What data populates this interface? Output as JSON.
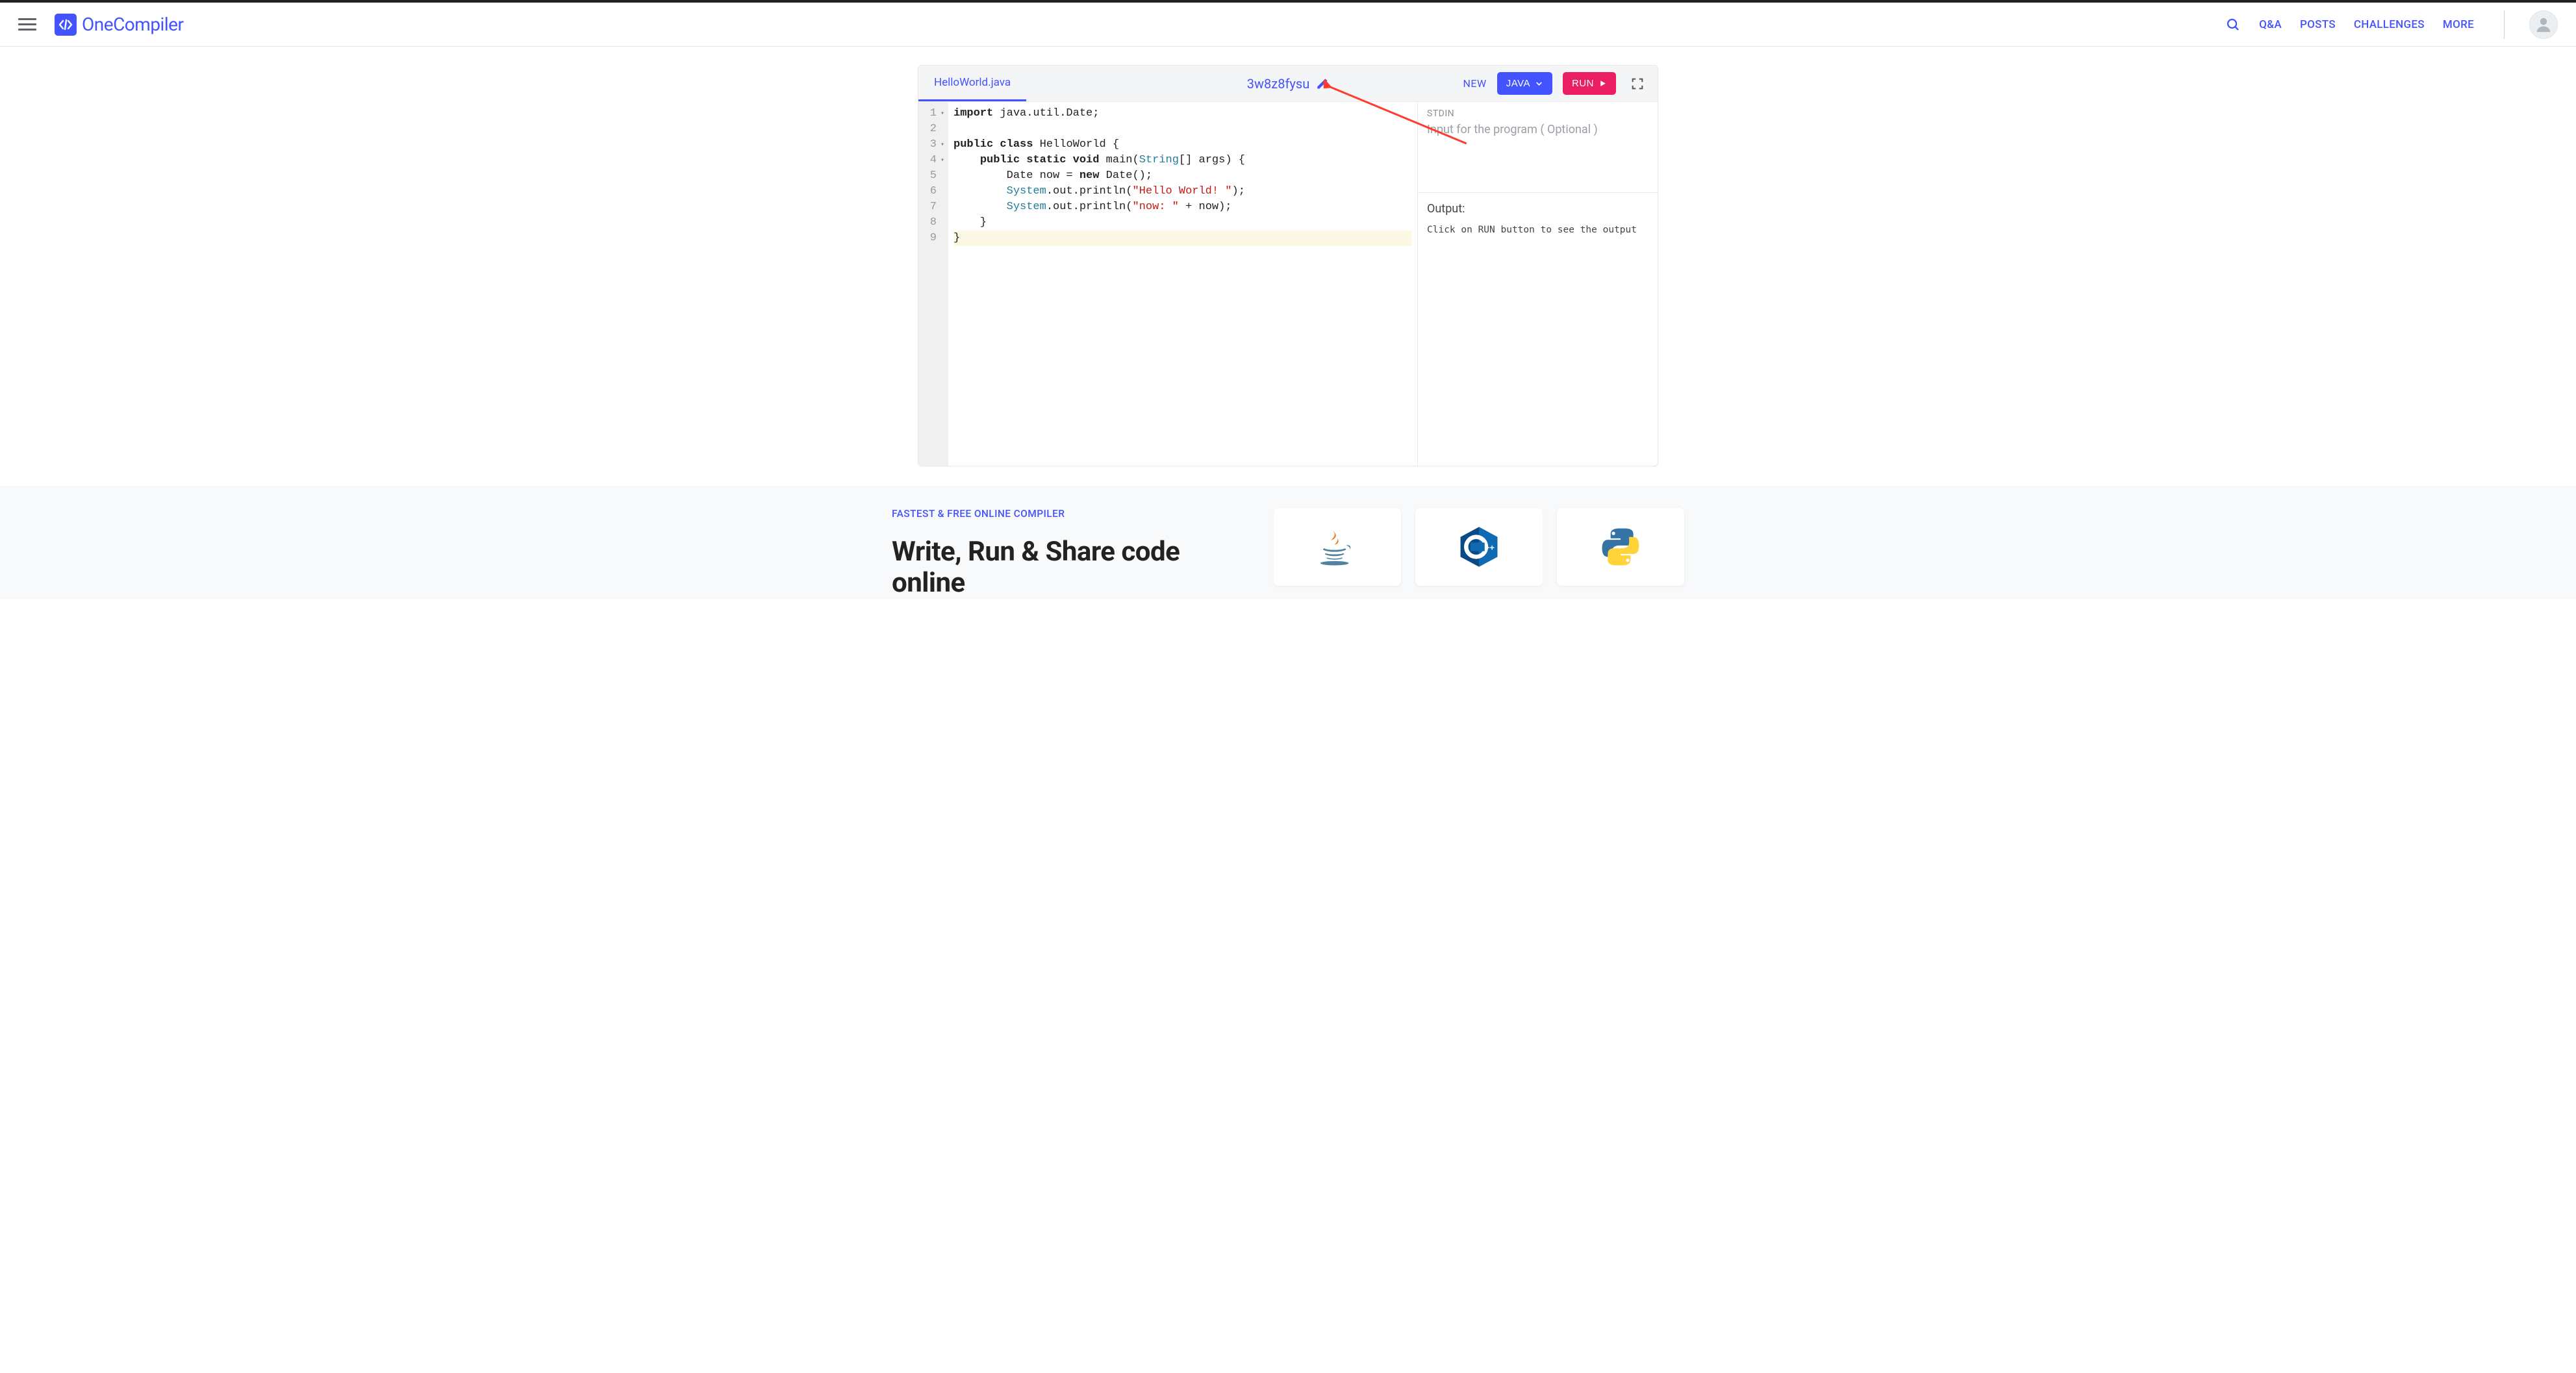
{
  "header": {
    "brand": "OneCompiler",
    "nav": {
      "qa": "Q&A",
      "posts": "POSTS",
      "challenges": "CHALLENGES",
      "more": "MORE"
    }
  },
  "panel": {
    "tab_filename": "HelloWorld.java",
    "snippet_id": "3w8z8fysu",
    "new_label": "NEW",
    "lang_label": "JAVA",
    "run_label": "RUN"
  },
  "code": {
    "lines": [
      {
        "n": "1",
        "fold": true,
        "tokens": [
          [
            "kw",
            "import"
          ],
          [
            "plain",
            " java.util.Date;"
          ]
        ]
      },
      {
        "n": "2",
        "fold": false,
        "tokens": []
      },
      {
        "n": "3",
        "fold": true,
        "tokens": [
          [
            "kw",
            "public"
          ],
          [
            "plain",
            " "
          ],
          [
            "kw",
            "class"
          ],
          [
            "plain",
            " HelloWorld {"
          ]
        ]
      },
      {
        "n": "4",
        "fold": true,
        "tokens": [
          [
            "plain",
            "    "
          ],
          [
            "kw",
            "public"
          ],
          [
            "plain",
            " "
          ],
          [
            "kw",
            "static"
          ],
          [
            "plain",
            " "
          ],
          [
            "kw",
            "void"
          ],
          [
            "plain",
            " main("
          ],
          [
            "type",
            "String"
          ],
          [
            "plain",
            "[] args) {"
          ]
        ]
      },
      {
        "n": "5",
        "fold": false,
        "tokens": [
          [
            "plain",
            "        Date now = "
          ],
          [
            "kw",
            "new"
          ],
          [
            "plain",
            " Date();"
          ]
        ]
      },
      {
        "n": "6",
        "fold": false,
        "tokens": [
          [
            "plain",
            "        "
          ],
          [
            "type",
            "System"
          ],
          [
            "plain",
            ".out.println("
          ],
          [
            "str",
            "\"Hello World! \""
          ],
          [
            "plain",
            ");"
          ]
        ]
      },
      {
        "n": "7",
        "fold": false,
        "tokens": [
          [
            "plain",
            "        "
          ],
          [
            "type",
            "System"
          ],
          [
            "plain",
            ".out.println("
          ],
          [
            "str",
            "\"now: \""
          ],
          [
            "plain",
            " + now);"
          ]
        ]
      },
      {
        "n": "8",
        "fold": false,
        "tokens": [
          [
            "plain",
            "    }"
          ]
        ]
      },
      {
        "n": "9",
        "fold": false,
        "hl": true,
        "tokens": [
          [
            "plain",
            "}"
          ]
        ]
      }
    ]
  },
  "io": {
    "stdin_label": "STDIN",
    "stdin_placeholder": "Input for the program ( Optional )",
    "output_label": "Output:",
    "output_text": "Click on RUN button to see the output"
  },
  "lower": {
    "tagline": "FASTEST & FREE ONLINE COMPILER",
    "headline": "Write, Run & Share code online",
    "langs": [
      "java",
      "cpp",
      "python"
    ]
  }
}
